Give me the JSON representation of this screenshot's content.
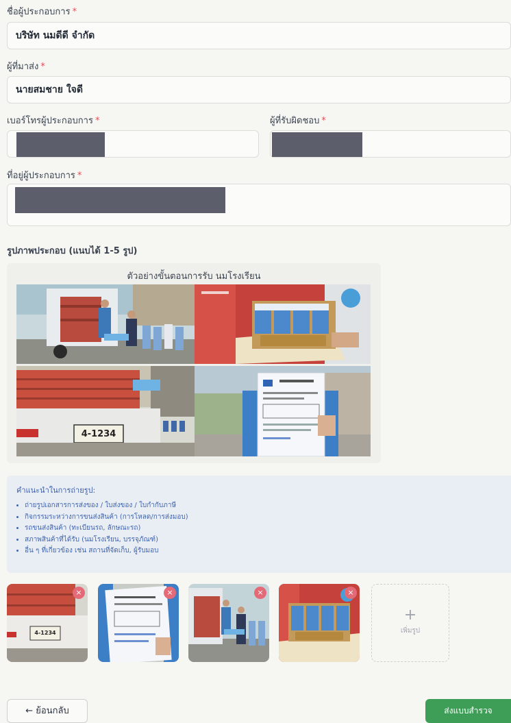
{
  "form": {
    "company_name": {
      "label": "ชื่อผู้ประกอบการ",
      "required_mark": "*",
      "value": "บริษัท นมดีดี จำกัด"
    },
    "sender": {
      "label": "ผู้ที่มาส่ง",
      "required_mark": "*",
      "value": "นายสมชาย ใจดี"
    },
    "phone": {
      "label": "เบอร์โทรผู้ประกอบการ",
      "required_mark": "*",
      "value": ""
    },
    "responsible": {
      "label": "ผู้ที่รับผิดชอบ",
      "required_mark": "*",
      "value": ""
    },
    "address": {
      "label": "ที่อยู่ผู้ประกอบการ",
      "required_mark": "*",
      "value": ""
    }
  },
  "photos": {
    "label": "รูปภาพประกอบ (แนบได้ 1-5 รูป)",
    "example_caption": "ตัวอย่างขั้นตอนการรับ นมโรงเรียน",
    "example_plate": "4-1234"
  },
  "tips": {
    "title": "คำแนะนำในการถ่ายรูป:",
    "items": [
      "ถ่ายรูปเอกสารการส่งของ / ใบส่งของ / ใบกำกับภาษี",
      "กิจกรรมระหว่างการขนส่งสินค้า (การโหลด/การส่งมอบ)",
      "รถขนส่งสินค้า (ทะเบียนรถ, ลักษณะรถ)",
      "สภาพสินค้าที่ได้รับ (นมโรงเรียน, บรรจุภัณฑ์)",
      "อื่น ๆ ที่เกี่ยวข้อง เช่น สถานที่จัดเก็บ, ผู้รับมอบ"
    ]
  },
  "uploads": {
    "remove_symbol": "×",
    "add_symbol": "+",
    "add_label": "เพิ่มรูป",
    "thumb1_plate": "4-1234"
  },
  "buttons": {
    "back": "← ย้อนกลับ",
    "submit": "ส่งแบบสำรวจ"
  },
  "colors": {
    "accent_green": "#3e9e57",
    "required_red": "#e0505a",
    "tip_blue": "#3f64b0",
    "remove_badge": "#e46a78"
  }
}
